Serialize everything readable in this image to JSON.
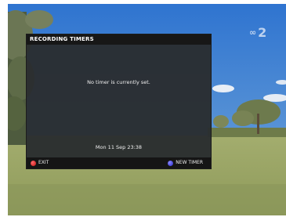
{
  "panel": {
    "title": "RECORDING TIMERS",
    "message": "No timer is currently set.",
    "datetime": "Mon 11 Sep 23:38"
  },
  "footer": {
    "exit": {
      "label": "EXIT",
      "color": "#d42020",
      "icon": "red-button-icon"
    },
    "new_timer": {
      "label": "NEW TIMER",
      "color": "#3a3ae0",
      "icon": "blue-button-icon"
    }
  },
  "channel_logo": {
    "text": "2",
    "icon": "abc-lissajous-icon"
  },
  "colors": {
    "sky": "#3d7fd3",
    "grass": "#9ba865",
    "panel_bg": "#2a2d2f",
    "header_bg": "#171717"
  }
}
